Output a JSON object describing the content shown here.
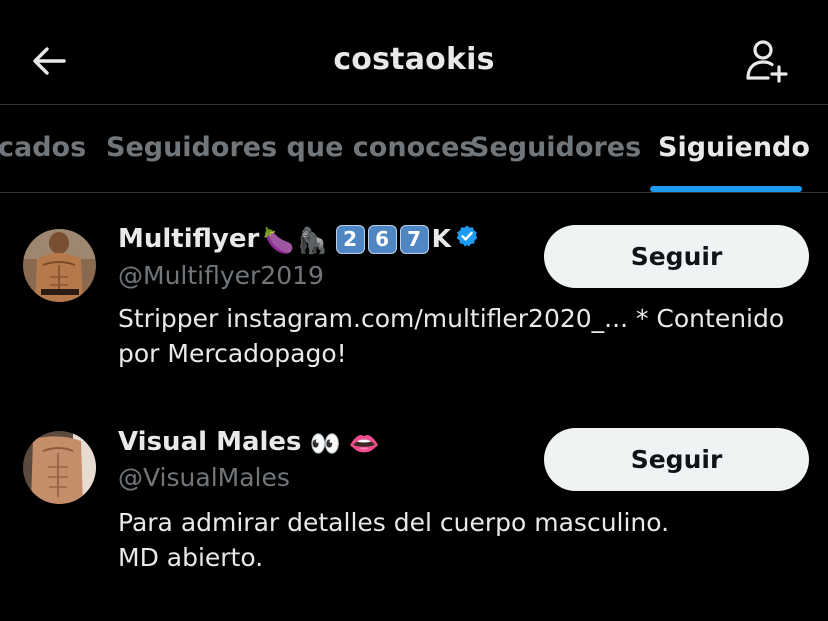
{
  "header": {
    "title": "costaokis",
    "back_icon": "arrow-left-icon",
    "add_user_icon": "person-add-icon"
  },
  "tabs": [
    {
      "label": "Verificados"
    },
    {
      "label": "Seguidores que conoces"
    },
    {
      "label": "Seguidores"
    },
    {
      "label": "Siguiendo",
      "active": true
    }
  ],
  "tabs_visible_first": "cados",
  "users": [
    {
      "name": "Multiflyer",
      "emojis": [
        "🍆",
        "🦍"
      ],
      "keycaps": [
        "2",
        "6",
        "7"
      ],
      "keycap_suffix": "K",
      "verified": true,
      "handle": "@Multiflyer2019",
      "bio_line1": "Stripper instagram.com/multifler2020_... * Contenido",
      "bio_line2": "por Mercadopago!",
      "follow_label": "Seguir"
    },
    {
      "name": "Visual Males",
      "emojis": [
        "👀",
        "👄"
      ],
      "verified": false,
      "handle": "@VisualMales",
      "bio_line1": "Para admirar detalles del cuerpo masculino.",
      "bio_line2": "MD abierto.",
      "follow_label": "Seguir"
    }
  ],
  "colors": {
    "background": "#000000",
    "text_primary": "#e7e9ea",
    "text_secondary": "#71767b",
    "accent": "#1d9bf0",
    "divider": "#2f3336",
    "button_bg": "#eff3f4",
    "button_text": "#0f1419"
  }
}
